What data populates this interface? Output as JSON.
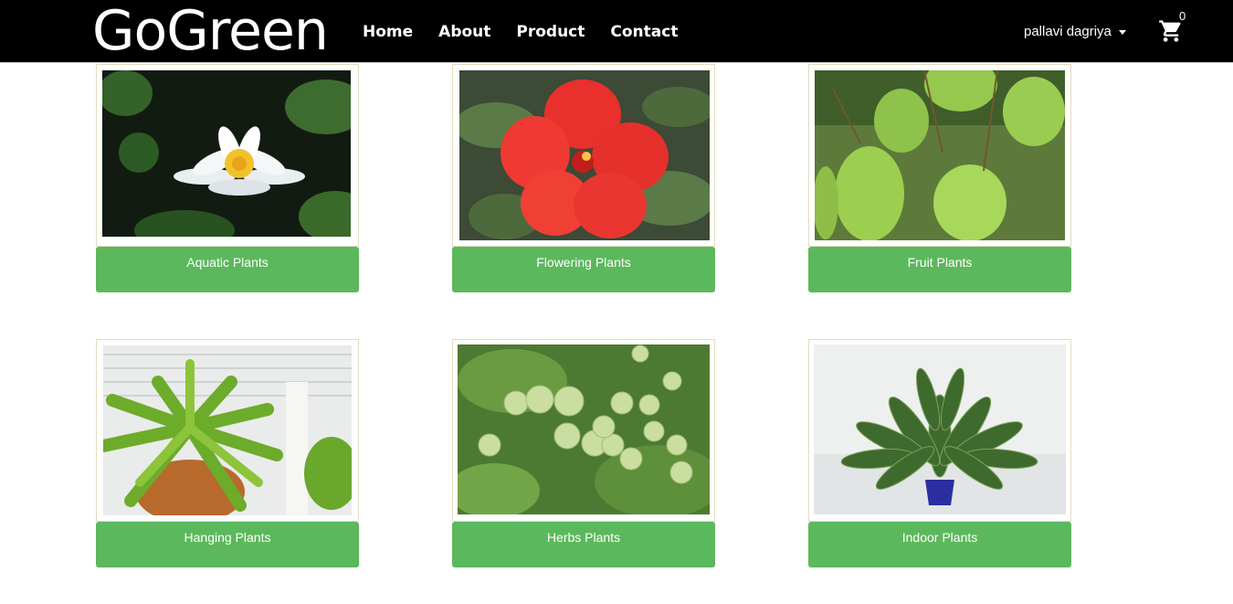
{
  "header": {
    "brand": "GoGreen",
    "nav": [
      "Home",
      "About",
      "Product",
      "Contact"
    ],
    "user_name": "pallavi dagriya",
    "cart_count": "0",
    "icons": [
      "chevron-down-icon",
      "shopping-cart-icon"
    ]
  },
  "categories": [
    {
      "label": "Aquatic Plants",
      "image": "white-water-lily"
    },
    {
      "label": "Flowering Plants",
      "image": "red-hibiscus"
    },
    {
      "label": "Fruit Plants",
      "image": "green-mangoes"
    },
    {
      "label": "Hanging Plants",
      "image": "hanging-fern-basket"
    },
    {
      "label": "Herbs Plants",
      "image": "gooseberry-branch"
    },
    {
      "label": "Indoor Plants",
      "image": "potted-dieffenbachia"
    }
  ],
  "colors": {
    "navbar": "#000000",
    "button": "#5cb85c",
    "button_text": "#ffffff",
    "card_border": "#e2dcc0"
  }
}
